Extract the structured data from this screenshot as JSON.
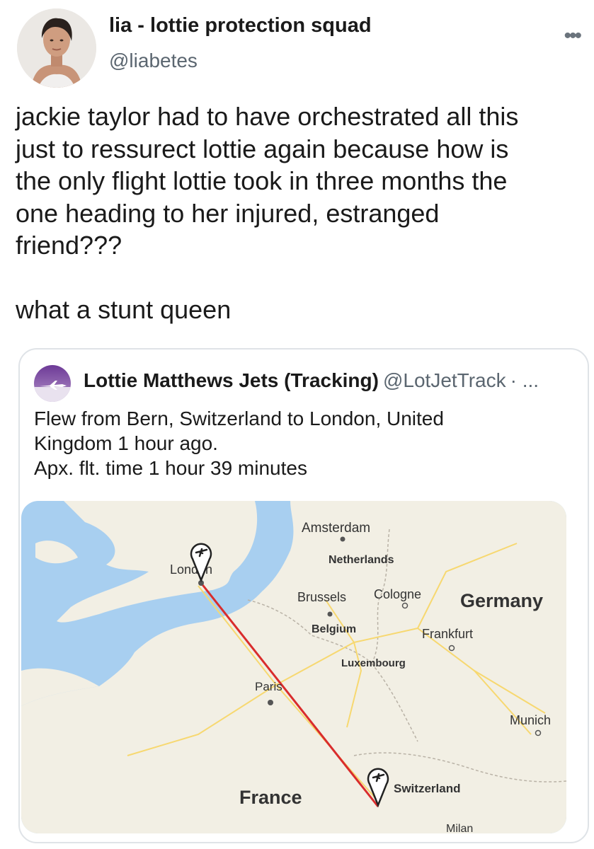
{
  "author": {
    "display_name": "lia - lottie protection squad",
    "handle": "@liabetes"
  },
  "tweet": {
    "text": "jackie taylor had to have orchestrated all this\njust to ressurect lottie again because how is\nthe only flight lottie took in three months the\none heading to her injured, estranged\nfriend???\n\nwhat a stunt queen"
  },
  "more_icon": "more-horizontal-icon",
  "quote": {
    "author_name": "Lottie Matthews Jets (Tracking)",
    "handle": "@LotJetTrack",
    "separator": "· ...",
    "text_lines": [
      "Flew from Bern, Switzerland to London, United",
      "Kingdom 1 hour ago.",
      "Apx. flt. time 1 hour 39 minutes"
    ],
    "avatar_icon": "airplane-icon",
    "avatar_color": "#7b3fa0"
  },
  "map": {
    "labels": {
      "london": "London",
      "amsterdam": "Amsterdam",
      "netherlands": "Netherlands",
      "brussels": "Brussels",
      "cologne": "Cologne",
      "germany": "Germany",
      "belgium": "Belgium",
      "frankfurt": "Frankfurt",
      "luxembourg": "Luxembourg",
      "paris": "Paris",
      "munich": "Munich",
      "france": "France",
      "switzerland": "Switzerland",
      "milan": "Milan"
    },
    "colors": {
      "sea": "#a8cff0",
      "land": "#f2efe4",
      "route": "#d92c2c"
    },
    "pin_icon": "airplane-pin-icon"
  }
}
